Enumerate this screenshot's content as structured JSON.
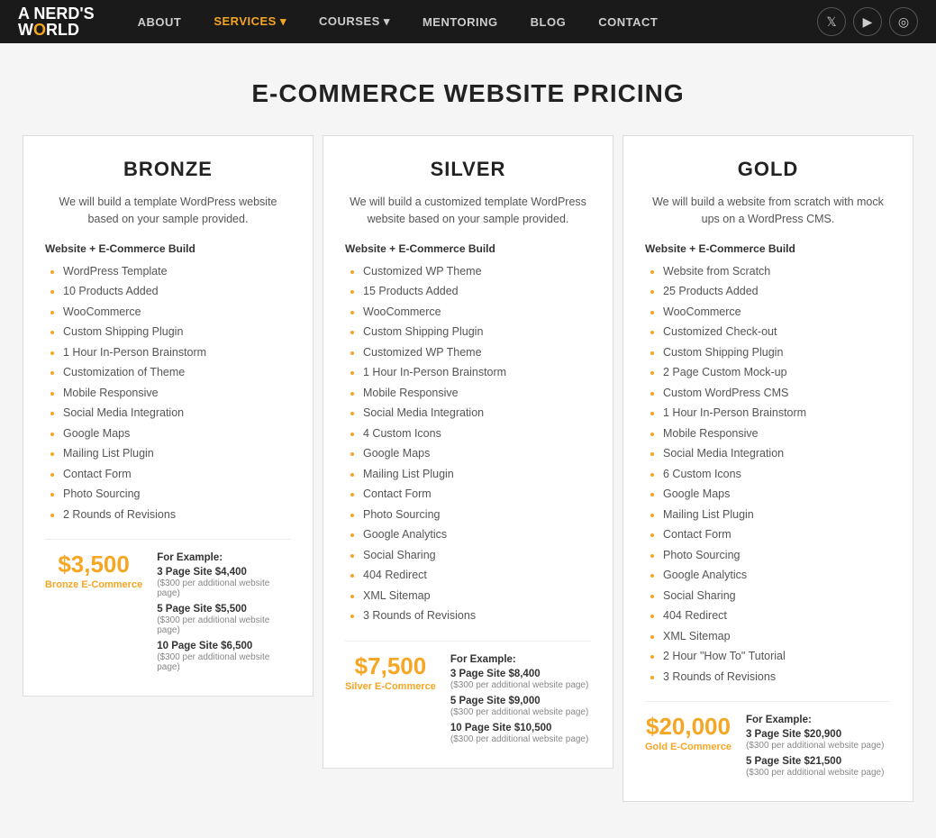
{
  "nav": {
    "logo_line1": "A NERD'S",
    "logo_line2": "WORLD",
    "links": [
      {
        "label": "ABOUT",
        "active": false
      },
      {
        "label": "SERVICES ▾",
        "active": true
      },
      {
        "label": "COURSES ▾",
        "active": false
      },
      {
        "label": "MENTORING",
        "active": false
      },
      {
        "label": "BLOG",
        "active": false
      },
      {
        "label": "CONTACT",
        "active": false
      }
    ],
    "icons": [
      "𝕏",
      "▶",
      "📷"
    ]
  },
  "page_title": "E-COMMERCE WEBSITE PRICING",
  "cards": [
    {
      "id": "bronze",
      "title": "BRONZE",
      "description": "We will build a template WordPress website based on your sample provided.",
      "section_header": "Website + E-Commerce Build",
      "features": [
        "WordPress Template",
        "10 Products Added",
        "WooCommerce",
        "Custom Shipping Plugin",
        "1 Hour In-Person Brainstorm",
        "Customization of Theme",
        "Mobile Responsive",
        "Social Media Integration",
        "Google Maps",
        "Mailing List Plugin",
        "Contact Form",
        "Photo Sourcing",
        "2 Rounds of Revisions"
      ],
      "for_example": "For Example:",
      "price": "$3,500",
      "price_label": "Bronze E-Commerce",
      "examples": [
        {
          "site": "3 Page Site $4,400",
          "note": "($300 per additional website page)"
        },
        {
          "site": "5 Page Site $5,500",
          "note": "($300 per additional website page)"
        },
        {
          "site": "10 Page Site $6,500",
          "note": "($300 per additional website page)"
        }
      ]
    },
    {
      "id": "silver",
      "title": "SILVER",
      "description": "We will build a customized template WordPress website based on your sample provided.",
      "section_header": "Website + E-Commerce Build",
      "features": [
        "Customized WP Theme",
        "15 Products Added",
        "WooCommerce",
        "Custom Shipping Plugin",
        "Customized WP Theme",
        "1 Hour In-Person Brainstorm",
        "Mobile Responsive",
        "Social Media Integration",
        "4 Custom Icons",
        "Google Maps",
        "Mailing List Plugin",
        "Contact Form",
        "Photo Sourcing",
        "Google Analytics",
        "Social Sharing",
        "404 Redirect",
        "XML Sitemap",
        "3 Rounds of Revisions"
      ],
      "for_example": "For Example:",
      "price": "$7,500",
      "price_label": "Silver E-Commerce",
      "examples": [
        {
          "site": "3 Page Site $8,400",
          "note": "($300 per additional website page)"
        },
        {
          "site": "5 Page Site $9,000",
          "note": "($300 per additional website page)"
        },
        {
          "site": "10 Page Site $10,500",
          "note": "($300 per additional website page)"
        }
      ]
    },
    {
      "id": "gold",
      "title": "GOLD",
      "description": "We will build a website from scratch with mock ups on a WordPress CMS.",
      "section_header": "Website + E-Commerce Build",
      "features": [
        "Website from Scratch",
        "25 Products Added",
        "WooCommerce",
        "Customized Check-out",
        "Custom Shipping Plugin",
        "2 Page Custom Mock-up",
        "Custom WordPress CMS",
        "1 Hour In-Person Brainstorm",
        "Mobile Responsive",
        "Social Media Integration",
        "6 Custom Icons",
        "Google Maps",
        "Mailing List Plugin",
        "Contact Form",
        "Photo Sourcing",
        "Google Analytics",
        "Social Sharing",
        "404 Redirect",
        "XML Sitemap",
        "2 Hour \"How To\" Tutorial",
        "3 Rounds of Revisions"
      ],
      "for_example": "For Example:",
      "price": "$20,000",
      "price_label": "Gold E-Commerce",
      "examples": [
        {
          "site": "3 Page Site $20,900",
          "note": "($300 per additional website page)"
        },
        {
          "site": "5 Page Site $21,500",
          "note": "($300 per additional website page)"
        }
      ]
    }
  ]
}
